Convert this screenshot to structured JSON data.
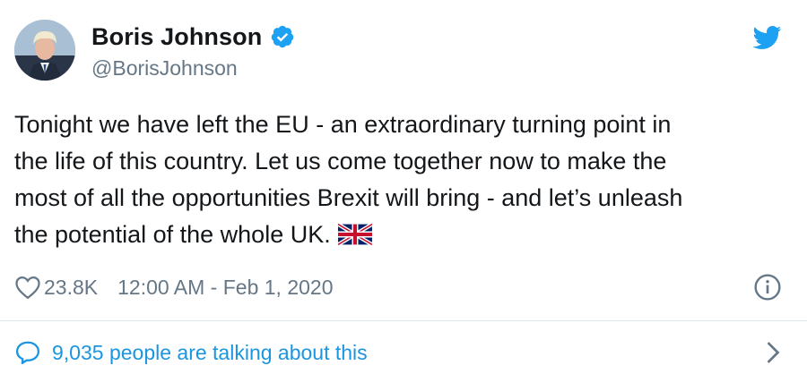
{
  "author": {
    "display_name": "Boris Johnson",
    "handle": "@BorisJohnson",
    "verified": true,
    "avatar_icon": "profile-photo"
  },
  "tweet": {
    "text": "Tonight we have left the EU - an extraordinary turning point in\nthe life of this country. Let us come together now to make the\nmost of all the opportunities Brexit will bring - and let’s unleash\nthe potential of the whole UK.",
    "emoji": "union-jack-flag"
  },
  "meta": {
    "likes": "23.8K",
    "timestamp": "12:00 AM - Feb 1, 2020"
  },
  "footer": {
    "talking_text": "9,035 people are talking about this"
  },
  "icons": {
    "brand": "twitter-bird-icon",
    "like": "heart-icon",
    "info": "info-icon",
    "reply": "speech-bubble-icon",
    "next": "chevron-right-icon"
  },
  "colors": {
    "twitter_blue": "#1da1f2",
    "link_blue": "#1b95e0",
    "text_primary": "#14171a",
    "text_secondary": "#657786",
    "divider": "#e1e8ed"
  }
}
